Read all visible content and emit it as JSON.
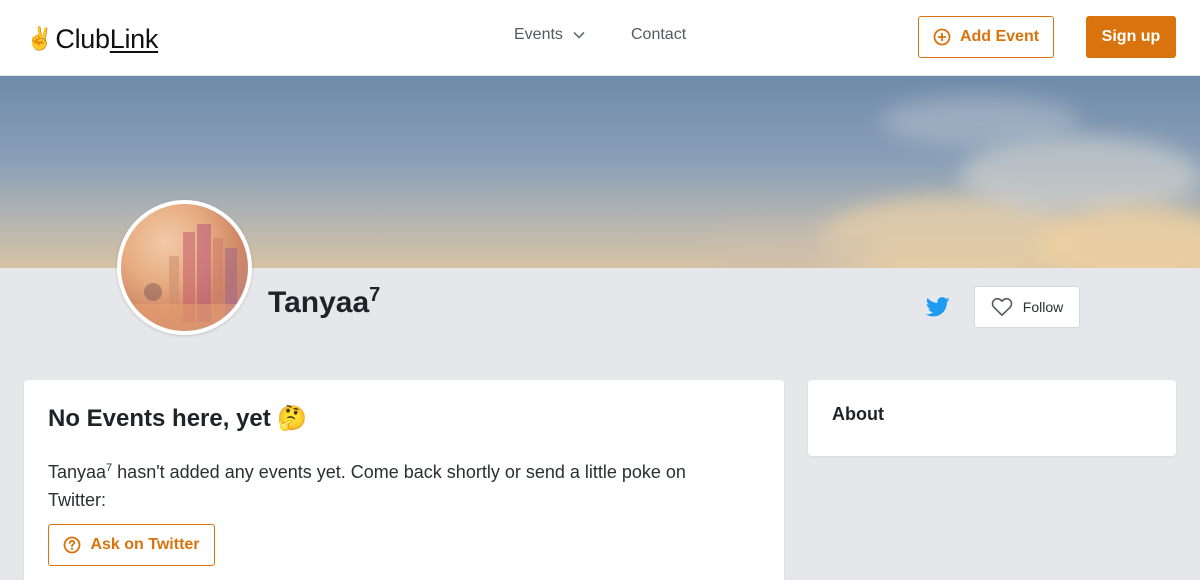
{
  "brand": {
    "hand_emoji": "✌️",
    "name_part1": "Club",
    "name_part2": "Link"
  },
  "nav": {
    "events_label": "Events",
    "contact_label": "Contact"
  },
  "actions": {
    "add_event_label": "Add Event",
    "signup_label": "Sign up"
  },
  "profile": {
    "name": "Tanyaa",
    "name_sup": "7",
    "follow_label": "Follow"
  },
  "events_panel": {
    "title": "No Events here, yet 🤔",
    "message_name": "Tanyaa",
    "message_sup": "7",
    "message_rest": " hasn't added any events yet. Come back shortly or send a little poke on Twitter:",
    "ask_label": "Ask on Twitter"
  },
  "about_panel": {
    "title": "About"
  },
  "colors": {
    "accent": "#d9730d",
    "twitter": "#1d9bf0",
    "background": "#e6e7ea"
  },
  "icons": [
    "chevron-down-icon",
    "plus-circle-icon",
    "twitter-icon",
    "heart-icon",
    "question-circle-icon"
  ]
}
